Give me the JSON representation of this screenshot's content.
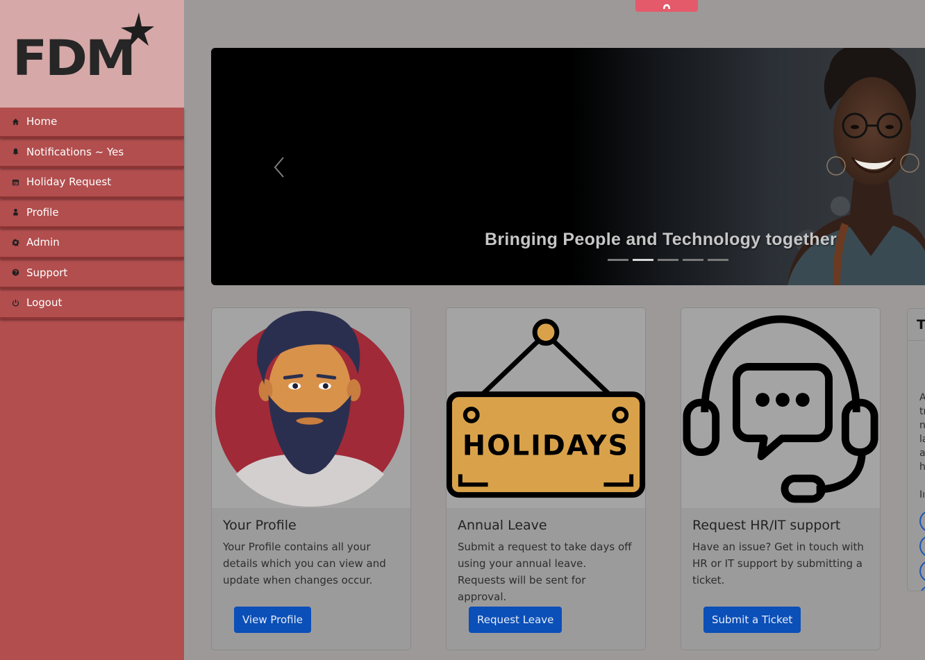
{
  "logo": {
    "text": "FDM"
  },
  "nav": [
    {
      "label": "Home",
      "icon": "home-icon"
    },
    {
      "label": "Notifications ~ Yes",
      "icon": "bell-icon"
    },
    {
      "label": "Holiday Request",
      "icon": "calendar-icon"
    },
    {
      "label": "Profile",
      "icon": "user-icon"
    },
    {
      "label": "Admin",
      "icon": "gear-icon"
    },
    {
      "label": "Support",
      "icon": "question-icon"
    },
    {
      "label": "Logout",
      "icon": "power-icon"
    }
  ],
  "carousel": {
    "caption": "Bringing People and Technology together",
    "slide_count": 5,
    "active_slide": 2
  },
  "cards": [
    {
      "title": "Your Profile",
      "text": "Your Profile contains all your details which you can view and update when changes occur.",
      "button": "View Profile"
    },
    {
      "title": "Annual Leave",
      "text": "Submit a request to take days off using your annual leave. Requests will be sent for approval.",
      "button": "Request Leave"
    },
    {
      "title": "Request HR/IT support",
      "text": "Have an issue? Get in touch with HR or IT support by submitting a ticket.",
      "button": "Submit a Ticket"
    }
  ],
  "holiday_sign_text": "HOLIDAYS",
  "side_card": {
    "title_fragment": "T",
    "line_fragments": [
      "A",
      "tı",
      "n",
      "la",
      "a",
      "h",
      "",
      "Iı"
    ]
  },
  "colors": {
    "sidebar": "#b24e4e",
    "logo_bg": "#d6a8a8",
    "button": "#0b4fb8",
    "overlay": "#9d9999"
  }
}
